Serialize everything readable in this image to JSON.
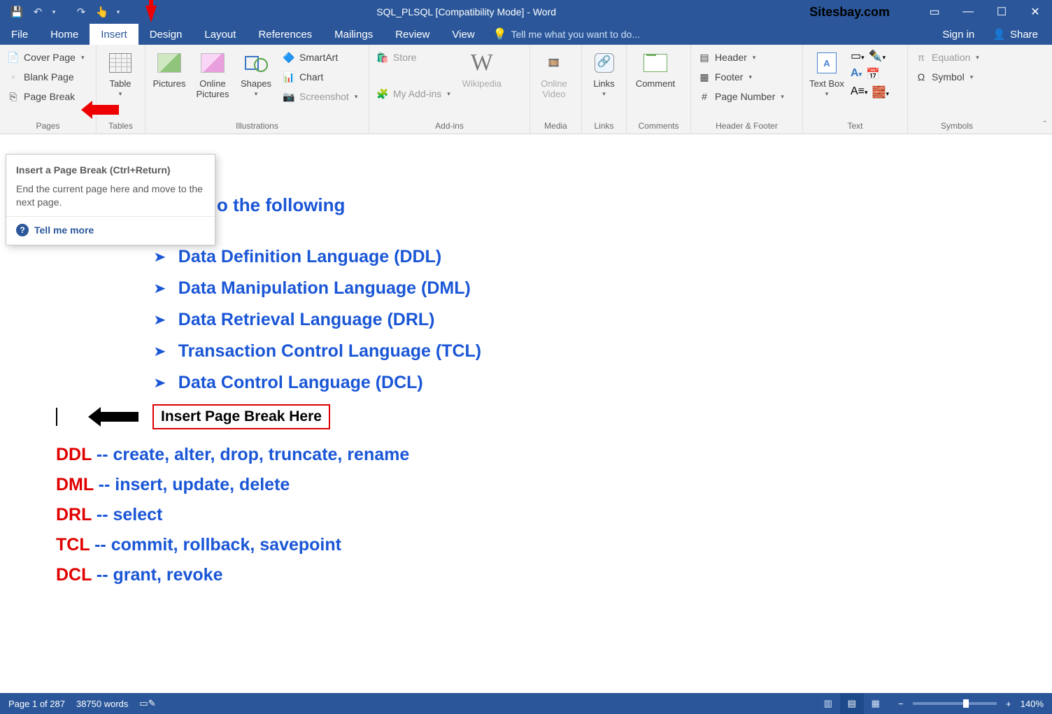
{
  "titlebar": {
    "doc_title": "SQL_PLSQL [Compatibility Mode] - Word",
    "brand": "Sitesbay.com"
  },
  "menu": {
    "tabs": [
      "File",
      "Home",
      "Insert",
      "Design",
      "Layout",
      "References",
      "Mailings",
      "Review",
      "View"
    ],
    "active": "Insert",
    "tell_me": "Tell me what you want to do...",
    "sign_in": "Sign in",
    "share": "Share"
  },
  "ribbon": {
    "pages": {
      "label": "Pages",
      "cover": "Cover Page",
      "blank": "Blank Page",
      "page_break": "Page Break"
    },
    "tables": {
      "label": "Tables",
      "table": "Table"
    },
    "illus": {
      "label": "Illustrations",
      "pictures": "Pictures",
      "online_pics": "Online Pictures",
      "shapes": "Shapes",
      "smartart": "SmartArt",
      "chart": "Chart",
      "screenshot": "Screenshot"
    },
    "addins": {
      "label": "Add-ins",
      "store": "Store",
      "myaddins": "My Add-ins",
      "wikipedia": "Wikipedia"
    },
    "media": {
      "label": "Media",
      "online_video": "Online Video"
    },
    "links": {
      "label": "Links",
      "links": "Links"
    },
    "comments": {
      "label": "Comments",
      "comment": "Comment"
    },
    "hf": {
      "label": "Header & Footer",
      "header": "Header",
      "footer": "Footer",
      "pagenum": "Page Number"
    },
    "text": {
      "label": "Text",
      "textbox": "Text Box"
    },
    "symbols": {
      "label": "Symbols",
      "equation": "Equation",
      "symbol": "Symbol"
    }
  },
  "tooltip": {
    "title": "Insert a Page Break (Ctrl+Return)",
    "body": "End the current page here and move to the next page.",
    "link": "Tell me more"
  },
  "document": {
    "heading_fragment": "o the following",
    "bullets": [
      "Data Definition Language (DDL)",
      "Data Manipulation Language (DML)",
      "Data Retrieval Language (DRL)",
      "Transaction Control Language (TCL)",
      "Data Control Language (DCL)"
    ],
    "page_break_label": "Insert Page Break Here",
    "definitions": [
      {
        "key": "DDL",
        "rest": " -- create, alter, drop, truncate, rename"
      },
      {
        "key": "DML",
        "rest": " -- insert, update, delete"
      },
      {
        "key": "DRL",
        "rest": " -- select"
      },
      {
        "key": "TCL",
        "rest": " -- commit, rollback, savepoint"
      },
      {
        "key": "DCL",
        "rest": " -- grant, revoke"
      }
    ]
  },
  "statusbar": {
    "page": "Page 1 of 287",
    "words": "38750 words",
    "zoom": "140%"
  }
}
